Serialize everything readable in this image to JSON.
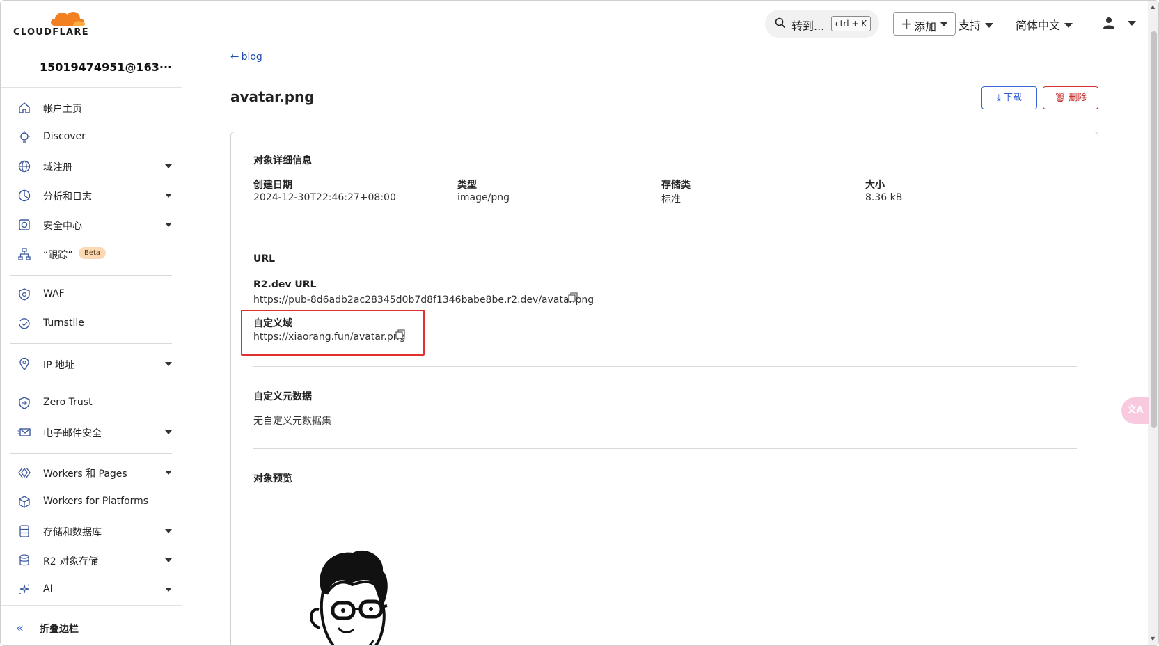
{
  "topbar": {
    "brand": "CLOUDFLARE",
    "search_label": "转到...",
    "search_shortcut": "ctrl + K",
    "add_label": "添加",
    "support_label": "支持",
    "language_label": "简体中文"
  },
  "sidebar": {
    "account": "15019474951@163···",
    "items": [
      {
        "label": "帐户主页",
        "icon": "home-icon"
      },
      {
        "label": "Discover",
        "icon": "lightbulb-icon"
      },
      {
        "label": "域注册",
        "icon": "globe-icon",
        "expandable": true
      },
      {
        "label": "分析和日志",
        "icon": "pie-chart-icon",
        "expandable": true
      },
      {
        "label": "安全中心",
        "icon": "shield-center-icon",
        "expandable": true
      },
      {
        "label": "“跟踪”",
        "icon": "sitemap-icon",
        "badge": "Beta"
      },
      {
        "label": "WAF",
        "icon": "waf-icon"
      },
      {
        "label": "Turnstile",
        "icon": "turnstile-icon"
      },
      {
        "label": "IP 地址",
        "icon": "location-pin-icon",
        "expandable": true
      },
      {
        "label": "Zero Trust",
        "icon": "zero-trust-icon"
      },
      {
        "label": "电子邮件安全",
        "icon": "email-icon",
        "expandable": true
      },
      {
        "label": "Workers 和 Pages",
        "icon": "workers-icon",
        "expandable": true
      },
      {
        "label": "Workers for Platforms",
        "icon": "cube-icon"
      },
      {
        "label": "存储和数据库",
        "icon": "database-icon",
        "expandable": true
      },
      {
        "label": "R2 对象存储",
        "icon": "storage-icon",
        "expandable": true
      },
      {
        "label": "AI",
        "icon": "sparkle-icon",
        "expandable": true
      }
    ],
    "collapse_label": "折叠边栏"
  },
  "main": {
    "breadcrumb": "blog",
    "title": "avatar.png",
    "download_label": "下载",
    "delete_label": "删除",
    "details": {
      "section_title": "对象详细信息",
      "fields": [
        {
          "label": "创建日期",
          "value": "2024-12-30T22:46:27+08:00"
        },
        {
          "label": "类型",
          "value": "image/png"
        },
        {
          "label": "存储类",
          "value": "标准"
        },
        {
          "label": "大小",
          "value": "8.36 kB"
        }
      ]
    },
    "url": {
      "section_title": "URL",
      "r2dev_label": "R2.dev URL",
      "r2dev_value": "https://pub-8d6adb2ac28345d0b7d8f1346babe8be.r2.dev/avatar.png",
      "custom_label": "自定义域",
      "custom_value": "https://xiaorang.fun/avatar.png"
    },
    "metadata": {
      "section_title": "自定义元数据",
      "empty_text": "无自定义元数据集"
    },
    "preview": {
      "section_title": "对象预览"
    }
  },
  "colors": {
    "brand_orange": "#f38020",
    "link_blue": "#1f4fae",
    "danger_red": "#d32f2f",
    "highlight_red": "#e0312f"
  }
}
